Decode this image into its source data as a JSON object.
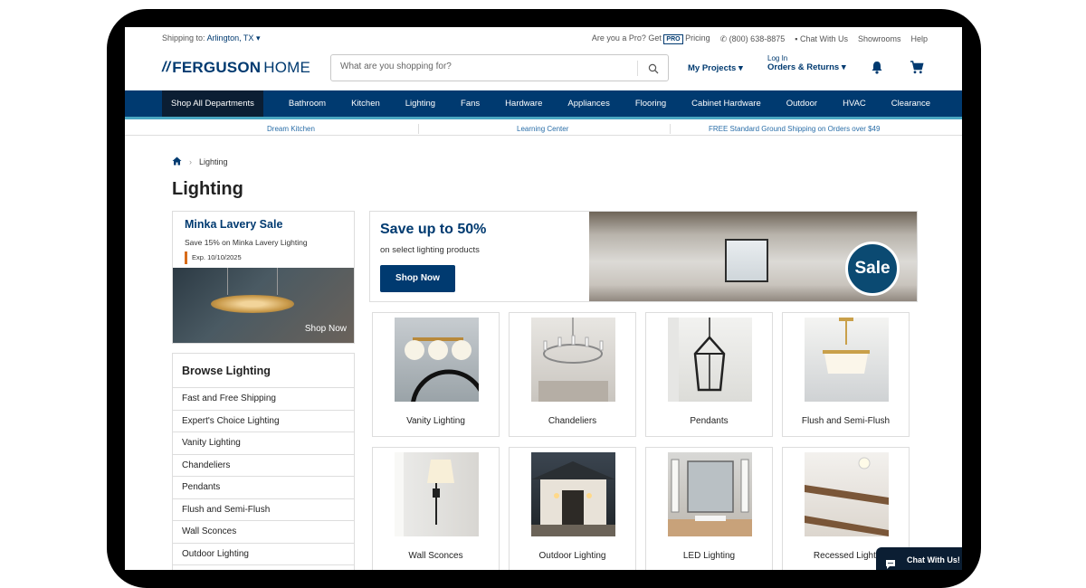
{
  "utility": {
    "shipping_label": "Shipping to:",
    "shipping_location": "Arlington, TX",
    "pro_text": "Are you a Pro? Get",
    "pro_badge": "PRO",
    "pro_pricing": "Pricing",
    "phone": "(800) 638-8875",
    "chat": "Chat With Us",
    "showrooms": "Showrooms",
    "help": "Help"
  },
  "header": {
    "logo_brand": "FERGUSON",
    "logo_suffix": "HOME",
    "search_placeholder": "What are you shopping for?",
    "my_projects": "My Projects",
    "login": "Log In",
    "orders": "Orders & Returns"
  },
  "nav": {
    "all": "Shop All Departments",
    "items": [
      "Bathroom",
      "Kitchen",
      "Lighting",
      "Fans",
      "Hardware",
      "Appliances",
      "Flooring",
      "Cabinet Hardware",
      "Outdoor",
      "HVAC",
      "Clearance"
    ]
  },
  "subnav": {
    "left": "Dream Kitchen",
    "center": "Learning Center",
    "right": "FREE Standard Ground Shipping on Orders over $49"
  },
  "breadcrumb": {
    "current": "Lighting"
  },
  "page_title": "Lighting",
  "promo": {
    "title": "Minka Lavery Sale",
    "desc": "Save 15% on Minka Lavery Lighting",
    "expiry": "Exp. 10/10/2025",
    "cta": "Shop Now"
  },
  "hero": {
    "title": "Save up to 50%",
    "subtitle": "on select lighting products",
    "cta": "Shop Now",
    "badge": "Sale"
  },
  "categories": [
    "Vanity Lighting",
    "Chandeliers",
    "Pendants",
    "Flush and Semi-Flush",
    "Wall Sconces",
    "Outdoor Lighting",
    "LED Lighting",
    "Recessed Lighti"
  ],
  "browse": {
    "title": "Browse Lighting",
    "items": [
      "Fast and Free Shipping",
      "Expert's Choice Lighting",
      "Vanity Lighting",
      "Chandeliers",
      "Pendants",
      "Flush and Semi-Flush",
      "Wall Sconces",
      "Outdoor Lighting"
    ]
  },
  "chat_widget": "Chat With Us!",
  "colors": {
    "brand": "#003a70",
    "accent": "#49a7c2",
    "nav_dark": "#0b1e33"
  }
}
